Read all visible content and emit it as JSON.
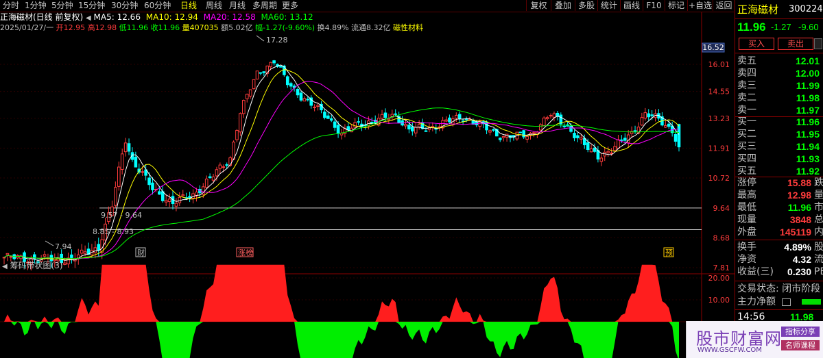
{
  "toolbar": {
    "timeframes": [
      "分时",
      "1分钟",
      "5分钟",
      "15分钟",
      "30分钟",
      "60分钟",
      "日线",
      "周线",
      "月线",
      "多周期",
      "更多"
    ],
    "active": "日线",
    "buttons": [
      "复权",
      "叠加",
      "多股",
      "统计",
      "画线",
      "F10",
      "标记",
      "+自选",
      "返回"
    ]
  },
  "info": {
    "title": "正海磁材(日线 前复权)",
    "ma5": "MA5: 12.66",
    "ma10": "MA10: 12.94",
    "ma20": "MA20: 12.58",
    "ma60": "MA60: 13.12",
    "date": "2025/01/27/一",
    "open": "开12.95",
    "high": "高12.98",
    "low": "低11.96",
    "close": "收11.96",
    "volume": "量407035",
    "amount": "额5.02亿",
    "change": "幅-1.27(-9.60%)",
    "turnover": "换4.89%",
    "float": "流通8.32亿",
    "sector": "磁性材料"
  },
  "price_axis": {
    "labels": [
      "16.01",
      "14.55",
      "13.23",
      "11.91",
      "10.72",
      "9.64",
      "8.68",
      "7.81"
    ],
    "current_tag": "16.52"
  },
  "annotations": {
    "high_label": "17.28",
    "low_label": "7.94",
    "range1": "9.57 - 9.64",
    "range2": "8.85 - 8.93",
    "event_cai": "财",
    "event_zhangbang": "涨榜",
    "event_yu": "预"
  },
  "indicator": {
    "title": "筹码带状图(3)",
    "axis": [
      "20.00",
      "10.00"
    ]
  },
  "colors": {
    "up": "#ff3c3c",
    "down": "#00ffff",
    "ma5": "#ffffff",
    "ma10": "#ffff00",
    "ma20": "#ff00ff",
    "ma60": "#00ff00",
    "grid": "#8b0000"
  },
  "quote": {
    "name": "正海磁材",
    "code": "300224",
    "price": "11.96",
    "chg": "-1.27",
    "pct": "-9.60",
    "buy_label": "买入",
    "sell_label": "卖出",
    "asks": [
      {
        "label": "卖五",
        "price": "12.01"
      },
      {
        "label": "卖四",
        "price": "12.00"
      },
      {
        "label": "卖三",
        "price": "11.99"
      },
      {
        "label": "卖二",
        "price": "11.98"
      },
      {
        "label": "卖一",
        "price": "11.97"
      }
    ],
    "bids": [
      {
        "label": "买一",
        "price": "11.96"
      },
      {
        "label": "买二",
        "price": "11.95"
      },
      {
        "label": "买三",
        "price": "11.94"
      },
      {
        "label": "买四",
        "price": "11.93"
      },
      {
        "label": "买五",
        "price": "11.92"
      }
    ],
    "stats": [
      {
        "label": "涨停",
        "value": "15.88",
        "extra": "跌"
      },
      {
        "label": "最高",
        "value": "12.98",
        "extra": "量"
      },
      {
        "label": "最低",
        "value": "11.96",
        "extra": "市"
      },
      {
        "label": "现量",
        "value": "3848",
        "extra": "总"
      },
      {
        "label": "外盘",
        "value": "145119",
        "extra": "内"
      }
    ],
    "stats2": [
      {
        "label": "换手",
        "value": "4.89%",
        "extra": "股"
      },
      {
        "label": "净资",
        "value": "4.32",
        "extra": "流"
      },
      {
        "label": "收益(三)",
        "value": "0.230",
        "extra": "PE"
      }
    ],
    "status": "交易状态: 闭市阶段",
    "main_net": "主力净额",
    "tick_time": "14:56",
    "tick_price": "11.98"
  },
  "watermark": {
    "title": "股市财富网",
    "url": "WWW.GSCFW.COM",
    "tag1": "指标分享",
    "tag2": "名师课程"
  }
}
